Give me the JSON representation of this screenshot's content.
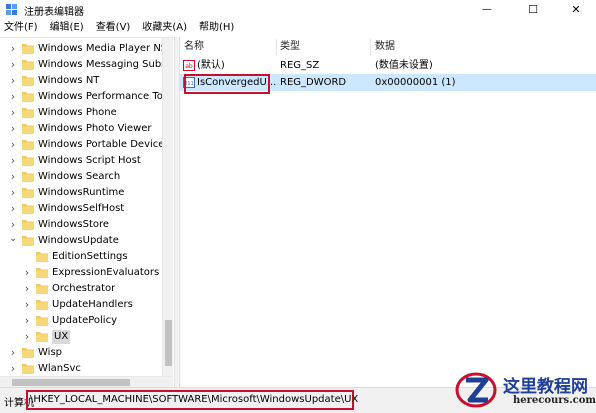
{
  "window": {
    "title": "注册表编辑器",
    "minimize_symbol": "—",
    "maximize_symbol": "☐",
    "close_symbol": "✕"
  },
  "menu": [
    {
      "label": "文件(F)"
    },
    {
      "label": "编辑(E)"
    },
    {
      "label": "查看(V)"
    },
    {
      "label": "收藏夹(A)"
    },
    {
      "label": "帮助(H)"
    }
  ],
  "tree": {
    "items": [
      {
        "label": "Windows Media Player NS",
        "expanded": false,
        "level": 0
      },
      {
        "label": "Windows Messaging Subs",
        "expanded": false,
        "level": 0
      },
      {
        "label": "Windows NT",
        "expanded": false,
        "level": 0
      },
      {
        "label": "Windows Performance Too",
        "expanded": false,
        "level": 0
      },
      {
        "label": "Windows Phone",
        "expanded": false,
        "level": 0
      },
      {
        "label": "Windows Photo Viewer",
        "expanded": false,
        "level": 0
      },
      {
        "label": "Windows Portable Devices",
        "expanded": false,
        "level": 0
      },
      {
        "label": "Windows Script Host",
        "expanded": false,
        "level": 0
      },
      {
        "label": "Windows Search",
        "expanded": false,
        "level": 0
      },
      {
        "label": "WindowsRuntime",
        "expanded": false,
        "level": 0
      },
      {
        "label": "WindowsSelfHost",
        "expanded": false,
        "level": 0
      },
      {
        "label": "WindowsStore",
        "expanded": false,
        "level": 0
      },
      {
        "label": "WindowsUpdate",
        "expanded": true,
        "level": 0
      },
      {
        "label": "EditionSettings",
        "expanded": null,
        "level": 1
      },
      {
        "label": "ExpressionEvaluators",
        "expanded": false,
        "level": 1
      },
      {
        "label": "Orchestrator",
        "expanded": false,
        "level": 1
      },
      {
        "label": "UpdateHandlers",
        "expanded": false,
        "level": 1
      },
      {
        "label": "UpdatePolicy",
        "expanded": false,
        "level": 1
      },
      {
        "label": "UX",
        "expanded": false,
        "level": 1,
        "selected": true
      },
      {
        "label": "Wisp",
        "expanded": false,
        "level": 0
      },
      {
        "label": "WlanSvc",
        "expanded": false,
        "level": 0
      }
    ]
  },
  "list": {
    "columns": {
      "name": "名称",
      "type": "类型",
      "data": "数据"
    },
    "rows": [
      {
        "name": "(默认)",
        "type": "REG_SZ",
        "data": "(数值未设置)",
        "icon": "string-value-icon",
        "icon_text": "ab"
      },
      {
        "name": "IsConvergedU...",
        "type": "REG_DWORD",
        "data": "0x00000001 (1)",
        "icon": "dword-value-icon",
        "icon_text": "011",
        "selected": true
      }
    ]
  },
  "status": {
    "prefix": "计算机",
    "path": "\\HKEY_LOCAL_MACHINE\\SOFTWARE\\Microsoft\\WindowsUpdate\\UX"
  },
  "watermark": {
    "cn": "这里教程网",
    "en": "herecours.com"
  },
  "colors": {
    "folder": "#f1c95c",
    "selection": "#cce8ff",
    "annotation_red": "#c8102e",
    "watermark_blue": "#1f3e96",
    "watermark_red": "#c8102e"
  }
}
